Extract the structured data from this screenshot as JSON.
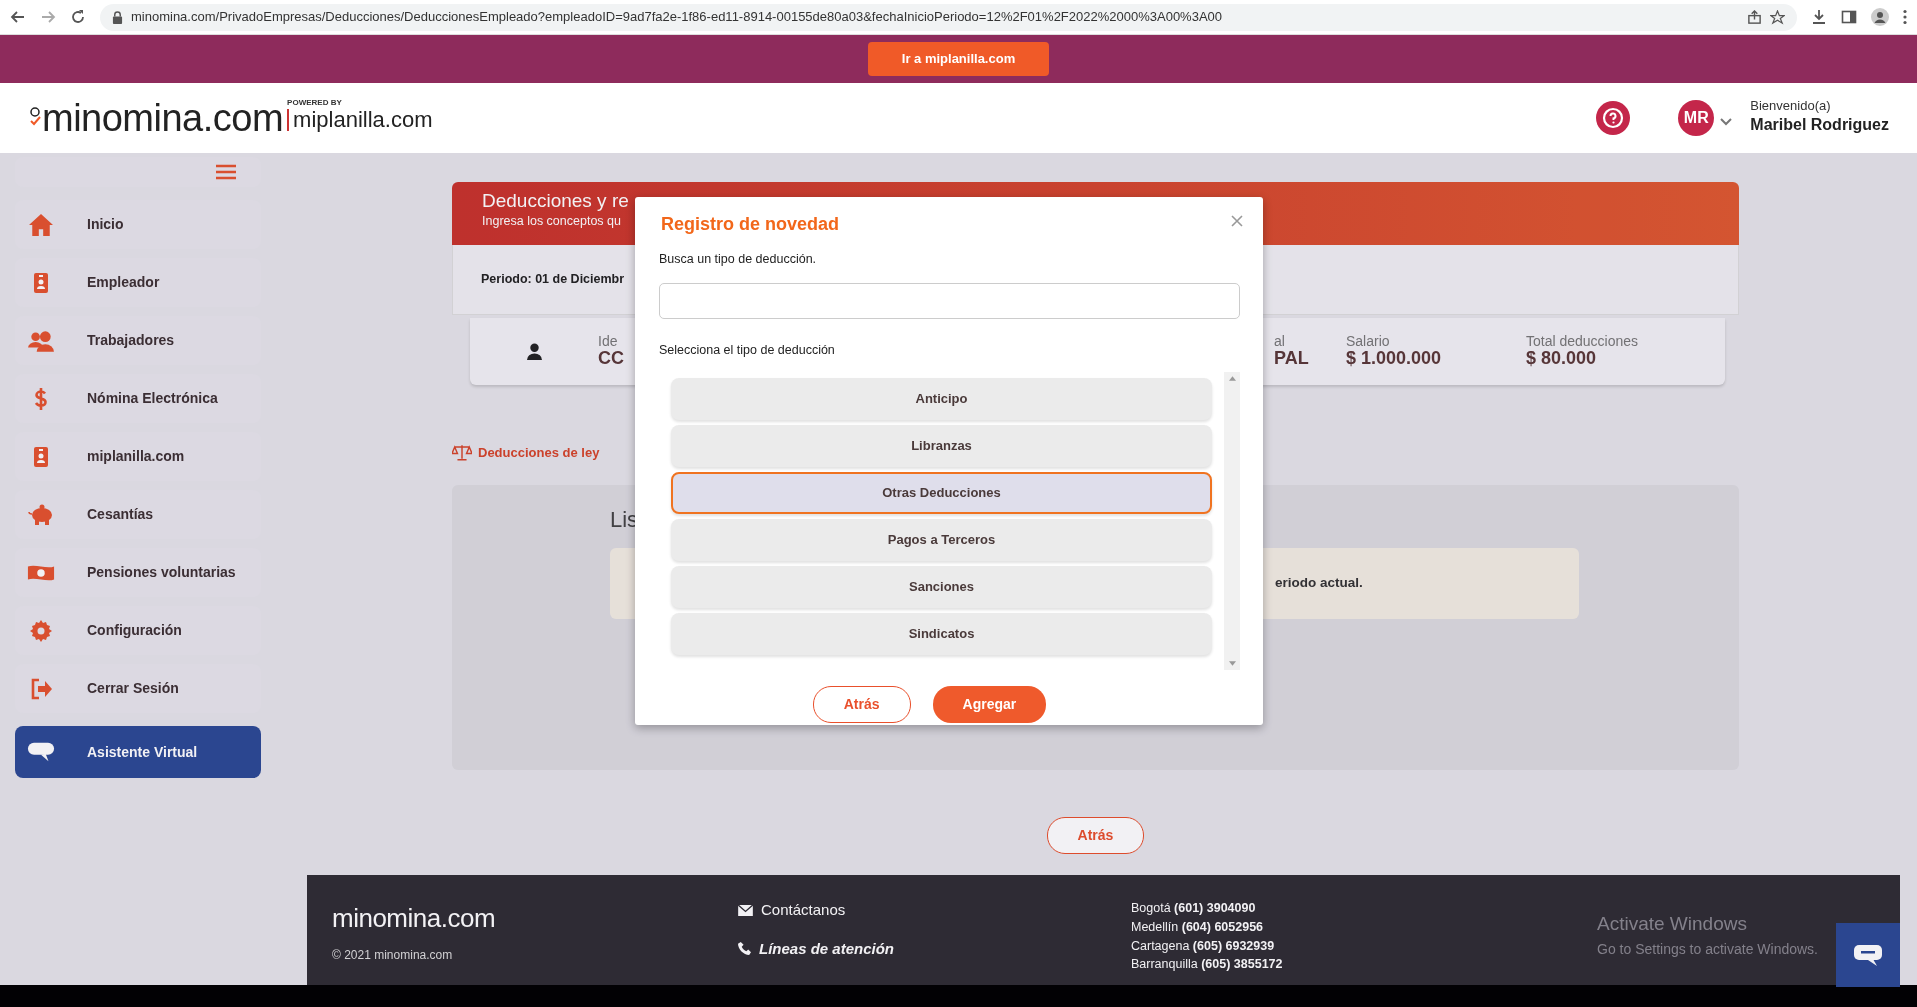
{
  "browser": {
    "url": "minomina.com/PrivadoEmpresas/Deducciones/DeduccionesEmpleado?empleadoID=9ad7fa2e-1f86-ed11-8914-00155de80a03&fechaInicioPeriodo=12%2F01%2F2022%2000%3A00%3A00"
  },
  "promo_bar": {
    "button": "Ir a miplanilla.com"
  },
  "header": {
    "logo": "minomina.com",
    "powered_by": "POWERED BY",
    "partner": "miplanilla.com",
    "avatar_initials": "MR",
    "greeting": "Bienvenido(a)",
    "user_name": "Maribel Rodriguez"
  },
  "sidebar": {
    "items": [
      {
        "label": "Inicio",
        "kind": "home",
        "accent": false
      },
      {
        "label": "Empleador",
        "kind": "badge",
        "accent": false
      },
      {
        "label": "Trabajadores",
        "kind": "users",
        "accent": false
      },
      {
        "label": "Nómina Electrónica",
        "kind": "dollar",
        "accent": false
      },
      {
        "label": "miplanilla.com",
        "kind": "badge",
        "accent": false
      },
      {
        "label": "Cesantías",
        "kind": "piggy",
        "accent": false
      },
      {
        "label": "Pensiones voluntarias",
        "kind": "money",
        "accent": false
      },
      {
        "label": "Configuración",
        "kind": "gear",
        "accent": false
      },
      {
        "label": "Cerrar Sesión",
        "kind": "logout",
        "accent": false
      },
      {
        "label": "Asistente Virtual",
        "kind": "chat",
        "accent": true
      }
    ]
  },
  "page": {
    "title": "Deducciones y re",
    "subtitle": "Ingresa los conceptos qu",
    "period": "Periodo: 01 de Diciembr",
    "employee_fields": [
      {
        "label": "Ide",
        "value": "CC"
      },
      {
        "label": "al",
        "value": "PAL"
      },
      {
        "label": "Salario",
        "value": "$ 1.000.000"
      },
      {
        "label": "Total deducciones",
        "value": "$ 80.000"
      }
    ],
    "law_link": "Deducciones de ley",
    "list_title": "Lis",
    "alert": "eriodo actual.",
    "back_button": "Atrás"
  },
  "modal": {
    "title": "Registro de novedad",
    "search_label": "Busca un tipo de deducción.",
    "list_label": "Selecciona el tipo de deducción",
    "options": [
      {
        "label": "Anticipo",
        "selected": false
      },
      {
        "label": "Libranzas",
        "selected": false
      },
      {
        "label": "Otras Deducciones",
        "selected": true
      },
      {
        "label": "Pagos a Terceros",
        "selected": false
      },
      {
        "label": "Sanciones",
        "selected": false
      },
      {
        "label": "Sindicatos",
        "selected": false
      }
    ],
    "back_button": "Atrás",
    "add_button": "Agregar"
  },
  "footer": {
    "logo": "minomina.com",
    "copyright": "© 2021 minomina.com",
    "contact": "Contáctanos",
    "support_lines": "Líneas de atención",
    "phones": [
      "Bogotá **(601) 3904090**",
      "Medellín **(604) 6052956**",
      "Cartagena **(605) 6932939**",
      "Barranquilla **(605) 3855172**"
    ]
  },
  "os_notice": {
    "title": "Activate Windows",
    "subtitle": "Go to Settings to activate Windows."
  }
}
